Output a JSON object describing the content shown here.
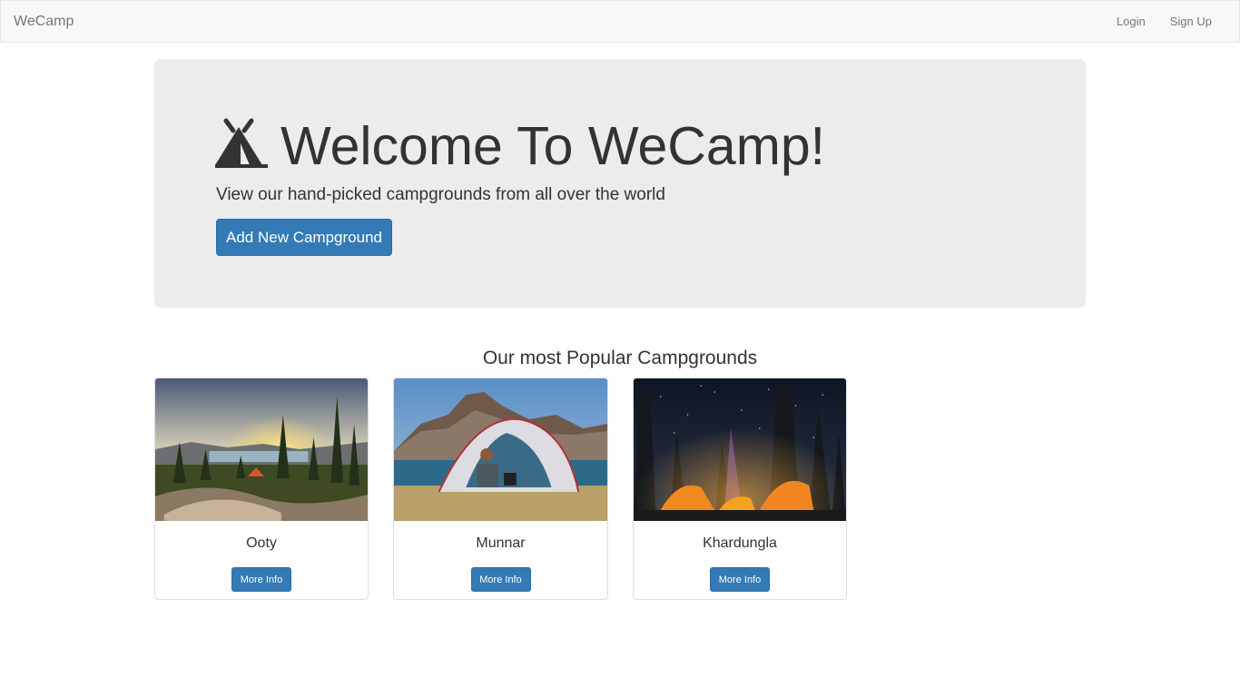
{
  "navbar": {
    "brand": "WeCamp",
    "links": [
      "Login",
      "Sign Up"
    ]
  },
  "hero": {
    "icon": "tent-icon",
    "title": "Welcome To WeCamp!",
    "subtitle": "View our hand-picked campgrounds from all over the world",
    "button_label": "Add New Campground"
  },
  "popular": {
    "title": "Our most Popular Campgrounds",
    "cards": [
      {
        "name": "Ooty",
        "button_label": "More Info",
        "image": "forest-sunset-photo"
      },
      {
        "name": "Munnar",
        "button_label": "More Info",
        "image": "tent-by-lake-photo"
      },
      {
        "name": "Khardungla",
        "button_label": "More Info",
        "image": "night-tents-photo"
      }
    ]
  },
  "colors": {
    "primary": "#337ab7",
    "navbar_bg": "#f8f8f8",
    "jumbotron_bg": "#ececec"
  }
}
